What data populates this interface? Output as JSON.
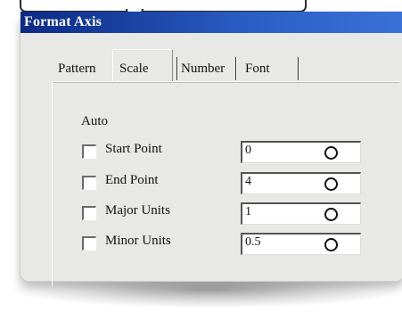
{
  "window": {
    "title": "Format Axis"
  },
  "tabs": [
    {
      "label": "Pattern",
      "active": false
    },
    {
      "label": "Scale",
      "active": true
    },
    {
      "label": "Number",
      "active": false
    },
    {
      "label": "Font",
      "active": false
    }
  ],
  "auto_group": {
    "label": "Auto",
    "rows": [
      {
        "label": "Start Point",
        "value": "0",
        "checked": false
      },
      {
        "label": "End Point",
        "value": "4",
        "checked": false
      },
      {
        "label": "Major Units",
        "value": "1",
        "checked": false
      },
      {
        "label": "Minor Units",
        "value": "0.5",
        "checked": false
      }
    ]
  },
  "colors": {
    "titlebar_start": "#0b2a85",
    "titlebar_end": "#3b72d8",
    "dialog_bg": "#e8e8e6"
  },
  "icons": {
    "marker": "circle-marker-icon",
    "pointer": "callout-pointer"
  }
}
